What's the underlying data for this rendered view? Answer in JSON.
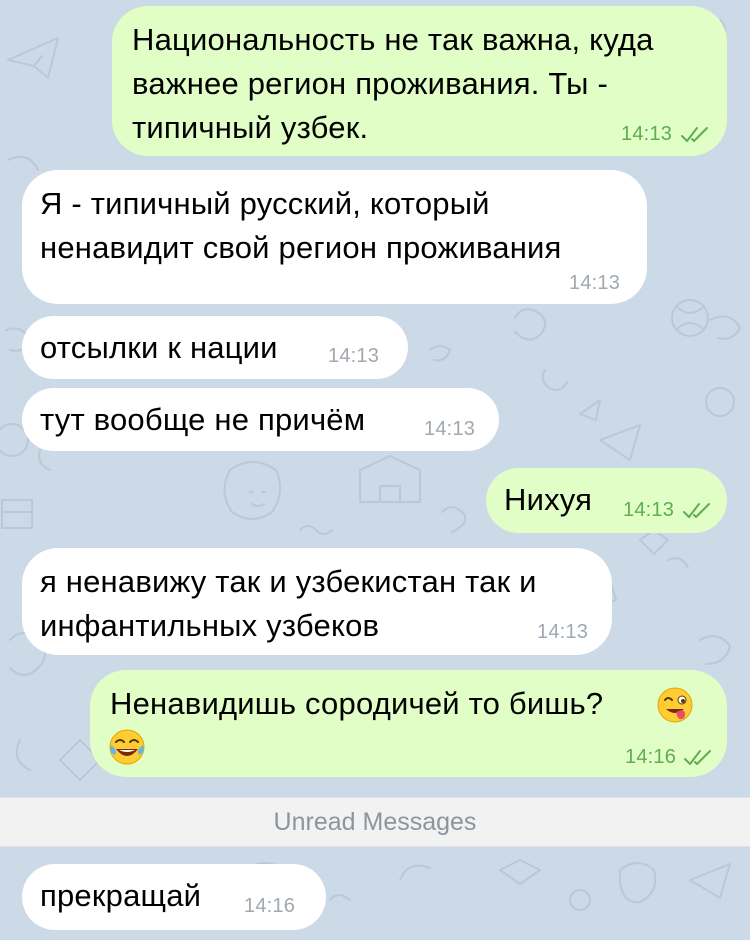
{
  "colors": {
    "background": "#ccd9e6",
    "outgoing_bubble": "#e1fec7",
    "incoming_bubble": "#ffffff",
    "outgoing_time": "#5fad51",
    "incoming_time": "#a0a8b0",
    "unread_bar": "#f2f2f2"
  },
  "messages": [
    {
      "direction": "outgoing",
      "text": "Национальность не так важна, куда\nважнее регион проживания. Ты -\nтипичный узбек.",
      "time": "14:13",
      "status": "read"
    },
    {
      "direction": "incoming",
      "text": "Я - типичный русский, который\nненавидит свой регион проживания",
      "time": "14:13"
    },
    {
      "direction": "incoming",
      "text": "отсылки к нации",
      "time": "14:13"
    },
    {
      "direction": "incoming",
      "text": "тут вообще не причём",
      "time": "14:13"
    },
    {
      "direction": "outgoing",
      "text": "Нихуя",
      "time": "14:13",
      "status": "read"
    },
    {
      "direction": "incoming",
      "text": "я ненавижу так и узбекистан так и\nинфантильных узбеков",
      "time": "14:13"
    },
    {
      "direction": "outgoing",
      "text": "Ненавидишь сородичей то бишь?",
      "time": "14:16",
      "status": "read",
      "emojis": [
        "winking-face-with-tongue-emoji",
        "face-with-tears-of-joy-emoji"
      ]
    }
  ],
  "unread_divider": "Unread Messages",
  "unread_messages": [
    {
      "direction": "incoming",
      "text": "прекращай",
      "time": "14:16"
    }
  ]
}
